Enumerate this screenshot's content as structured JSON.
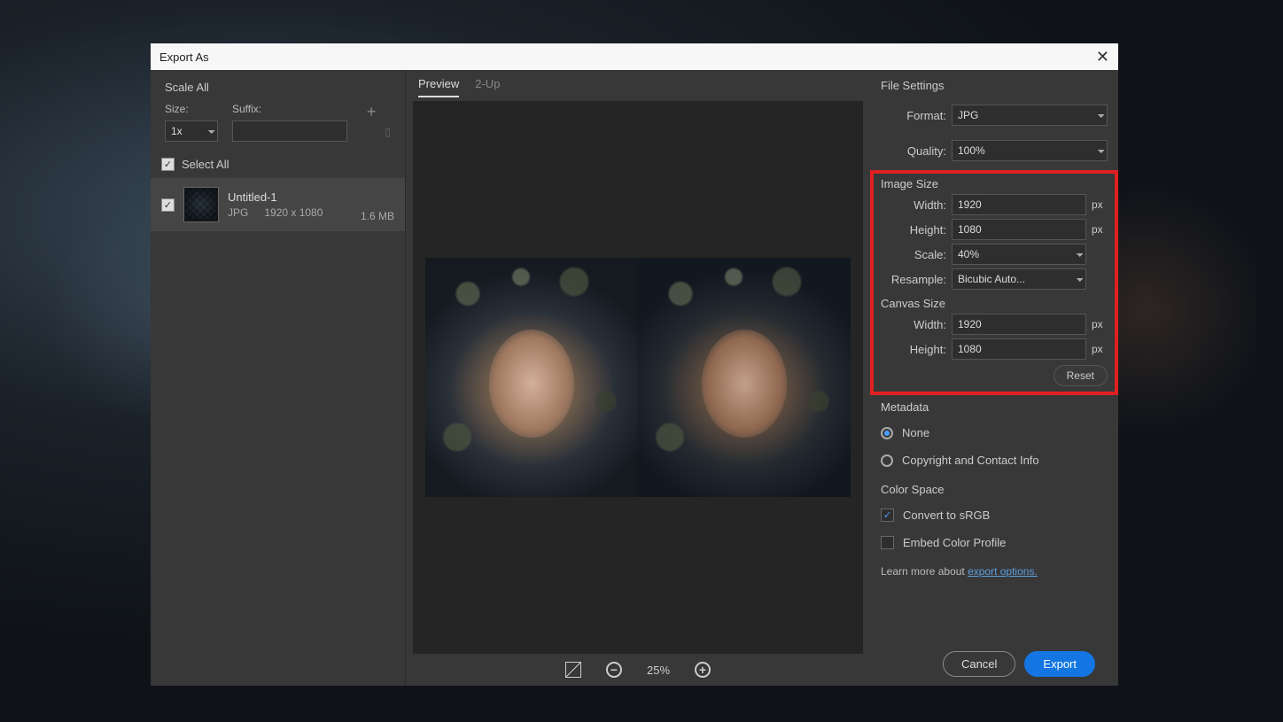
{
  "dialog": {
    "title": "Export As"
  },
  "left": {
    "scale_all": "Scale All",
    "size_lbl": "Size:",
    "suffix_lbl": "Suffix:",
    "size_value": "1x",
    "select_all": "Select All",
    "file": {
      "name": "Untitled-1",
      "format": "JPG",
      "dims": "1920 x 1080",
      "size": "1.6 MB"
    }
  },
  "center": {
    "tabs": {
      "preview": "Preview",
      "two_up": "2-Up"
    },
    "zoom": "25%"
  },
  "right": {
    "file_settings": "File Settings",
    "format_lbl": "Format:",
    "format_val": "JPG",
    "quality_lbl": "Quality:",
    "quality_val": "100%",
    "image_size": "Image Size",
    "width_lbl": "Width:",
    "is_width": "1920",
    "height_lbl": "Height:",
    "is_height": "1080",
    "scale_lbl": "Scale:",
    "scale_val": "40%",
    "resample_lbl": "Resample:",
    "resample_val": "Bicubic Auto...",
    "canvas_size": "Canvas Size",
    "cs_width": "1920",
    "cs_height": "1080",
    "reset": "Reset",
    "px": "px",
    "metadata": "Metadata",
    "meta_none": "None",
    "meta_cc": "Copyright and Contact Info",
    "color_space": "Color Space",
    "convert_srgb": "Convert to sRGB",
    "embed_profile": "Embed Color Profile",
    "learn_more": "Learn more about ",
    "learn_link": "export options."
  },
  "footer": {
    "cancel": "Cancel",
    "export": "Export"
  }
}
